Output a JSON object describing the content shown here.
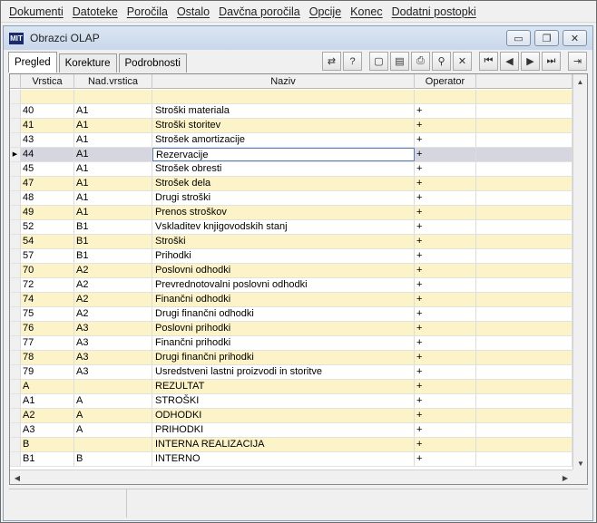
{
  "menu": [
    "Dokumenti",
    "Datoteke",
    "Poročila",
    "Ostalo",
    "Davčna poročila",
    "Opcije",
    "Konec",
    "Dodatni postopki"
  ],
  "window": {
    "title": "Obrazci OLAP",
    "icon_text": "MIT",
    "buttons": {
      "minimize": "▭",
      "restore": "❐",
      "close": "✕"
    }
  },
  "tabs": [
    "Pregled",
    "Korekture",
    "Podrobnosti"
  ],
  "active_tab": "Pregled",
  "toolbar": [
    {
      "name": "export-icon",
      "glyph": "⇄"
    },
    {
      "name": "help-icon",
      "glyph": "?"
    },
    {
      "name": "new-document-icon",
      "glyph": "▢"
    },
    {
      "name": "open-folder-icon",
      "glyph": "▤"
    },
    {
      "name": "print-icon",
      "glyph": "⎙"
    },
    {
      "name": "search-icon",
      "glyph": "⚲"
    },
    {
      "name": "delete-icon",
      "glyph": "✕"
    },
    {
      "name": "first-record-icon",
      "glyph": "⏮"
    },
    {
      "name": "prev-record-icon",
      "glyph": "◀"
    },
    {
      "name": "next-record-icon",
      "glyph": "▶"
    },
    {
      "name": "last-record-icon",
      "glyph": "⏭"
    },
    {
      "name": "exit-icon",
      "glyph": "⇥"
    }
  ],
  "grid": {
    "columns": [
      "Vrstica",
      "Nad.vrstica",
      "Naziv",
      "Operator"
    ],
    "rows": [
      {
        "vrstica": "",
        "nad": "",
        "naziv": "",
        "op": ""
      },
      {
        "vrstica": "40",
        "nad": "A1",
        "naziv": "Stroški materiala",
        "op": "+"
      },
      {
        "vrstica": "41",
        "nad": "A1",
        "naziv": "Stroški storitev",
        "op": "+"
      },
      {
        "vrstica": "43",
        "nad": "A1",
        "naziv": "Strošek amortizacije",
        "op": "+"
      },
      {
        "vrstica": "44",
        "nad": "A1",
        "naziv": "Rezervacije",
        "op": "+"
      },
      {
        "vrstica": "45",
        "nad": "A1",
        "naziv": "Strošek obresti",
        "op": "+"
      },
      {
        "vrstica": "47",
        "nad": "A1",
        "naziv": "Strošek dela",
        "op": "+"
      },
      {
        "vrstica": "48",
        "nad": "A1",
        "naziv": "Drugi stroški",
        "op": "+"
      },
      {
        "vrstica": "49",
        "nad": "A1",
        "naziv": "Prenos stroškov",
        "op": "+"
      },
      {
        "vrstica": "52",
        "nad": "B1",
        "naziv": "Vskladitev knjigovodskih stanj",
        "op": "+"
      },
      {
        "vrstica": "54",
        "nad": "B1",
        "naziv": "Stroški",
        "op": "+"
      },
      {
        "vrstica": "57",
        "nad": "B1",
        "naziv": "Prihodki",
        "op": "+"
      },
      {
        "vrstica": "70",
        "nad": "A2",
        "naziv": "Poslovni odhodki",
        "op": "+"
      },
      {
        "vrstica": "72",
        "nad": "A2",
        "naziv": "Prevrednotovalni poslovni odhodki",
        "op": "+"
      },
      {
        "vrstica": "74",
        "nad": "A2",
        "naziv": "Finančni odhodki",
        "op": "+"
      },
      {
        "vrstica": "75",
        "nad": "A2",
        "naziv": "Drugi finančni odhodki",
        "op": "+"
      },
      {
        "vrstica": "76",
        "nad": "A3",
        "naziv": "Poslovni prihodki",
        "op": "+"
      },
      {
        "vrstica": "77",
        "nad": "A3",
        "naziv": "Finančni prihodki",
        "op": "+"
      },
      {
        "vrstica": "78",
        "nad": "A3",
        "naziv": "Drugi finančni prihodki",
        "op": "+"
      },
      {
        "vrstica": "79",
        "nad": "A3",
        "naziv": "Usredstveni lastni proizvodi in storitve",
        "op": "+"
      },
      {
        "vrstica": "A",
        "nad": "",
        "naziv": "REZULTAT",
        "op": "+"
      },
      {
        "vrstica": "A1",
        "nad": "A",
        "naziv": "STROŠKI",
        "op": "+"
      },
      {
        "vrstica": "A2",
        "nad": "A",
        "naziv": "ODHODKI",
        "op": "+"
      },
      {
        "vrstica": "A3",
        "nad": "A",
        "naziv": "PRIHODKI",
        "op": "+"
      },
      {
        "vrstica": "B",
        "nad": "",
        "naziv": "INTERNA REALIZACIJA",
        "op": "+"
      },
      {
        "vrstica": "B1",
        "nad": "B",
        "naziv": "INTERNO",
        "op": "+"
      }
    ],
    "selected_row_index": 4,
    "current_row_marker": "▶"
  },
  "colors": {
    "alt_row": "#fdf3c9",
    "selected_row": "#d6d6e0",
    "titlebar": "#c8d7ea"
  }
}
